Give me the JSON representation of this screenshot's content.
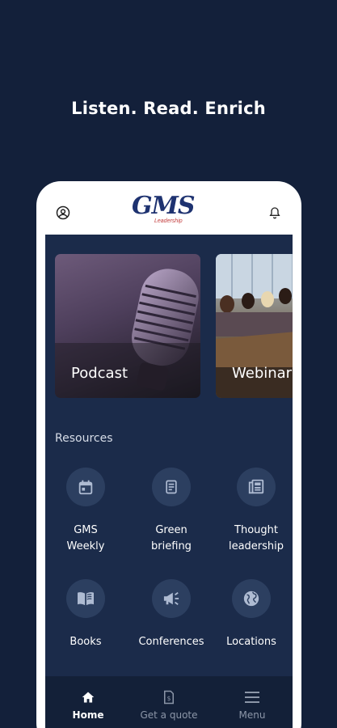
{
  "headline": "Listen. Read. Enrich",
  "app_bar": {
    "logo_text": "GMS",
    "logo_subtext": "Leadership",
    "left_icon": "account-circle-icon",
    "right_icon": "bell-icon"
  },
  "featured_cards": [
    {
      "label": "Podcast",
      "icon": "microphone-image"
    },
    {
      "label": "Webinar",
      "icon": "meeting-image"
    }
  ],
  "resources": {
    "title": "Resources",
    "items": [
      {
        "label": "GMS\nWeekly",
        "icon": "calendar-icon"
      },
      {
        "label": "Green\nbriefing",
        "icon": "document-icon"
      },
      {
        "label": "Thought\nleadership",
        "icon": "newspaper-icon"
      },
      {
        "label": "Books",
        "icon": "book-icon"
      },
      {
        "label": "Conferences",
        "icon": "megaphone-icon"
      },
      {
        "label": "Locations",
        "icon": "globe-icon"
      }
    ]
  },
  "bottom_nav": {
    "items": [
      {
        "label": "Home",
        "icon": "home-icon",
        "active": true
      },
      {
        "label": "Get a quote",
        "icon": "quote-document-icon",
        "active": false
      },
      {
        "label": "Menu",
        "icon": "menu-icon",
        "active": false
      }
    ]
  },
  "colors": {
    "page_background": "#13203a",
    "screen_background": "#1b2b4a",
    "icon_circle": "#2c3f60",
    "logo_blue": "#1e3270",
    "logo_red": "#c23a3a"
  }
}
